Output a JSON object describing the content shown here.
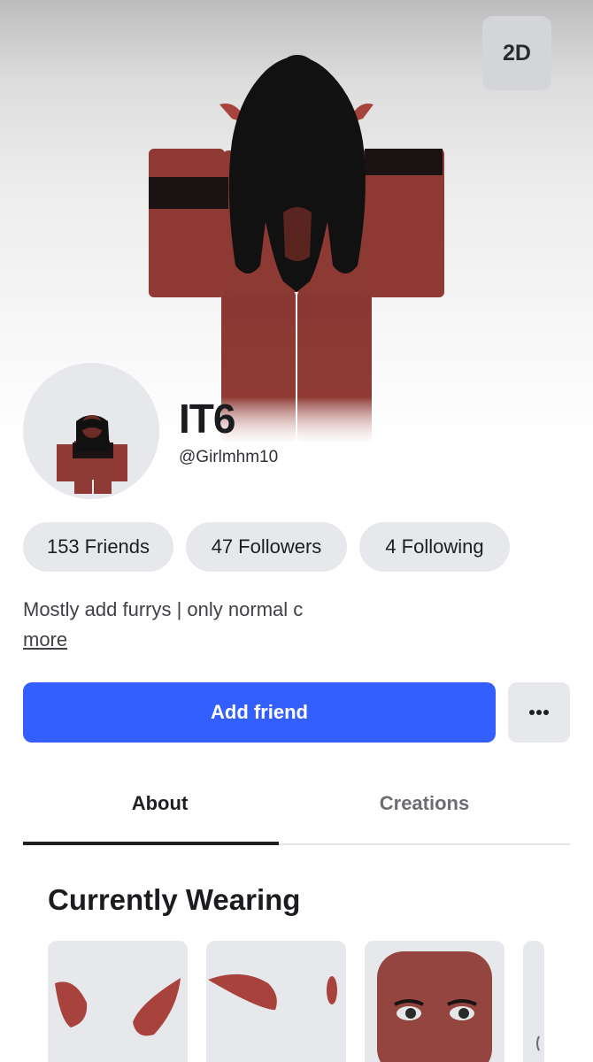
{
  "hero": {
    "view_toggle_label": "2D"
  },
  "profile": {
    "display_name": "IT6",
    "username": "@Girlmhm10"
  },
  "stats": [
    {
      "count": "153",
      "label": "Friends"
    },
    {
      "count": "47",
      "label": "Followers"
    },
    {
      "count": "4",
      "label": "Following"
    }
  ],
  "bio": {
    "text": "Mostly add furrys | only normal c",
    "more_label": "more"
  },
  "actions": {
    "add_friend_label": "Add friend",
    "more_options_icon": "ellipsis-icon"
  },
  "tabs": [
    {
      "label": "About",
      "active": true
    },
    {
      "label": "Creations",
      "active": false
    }
  ],
  "wearing": {
    "title": "Currently Wearing",
    "items": [
      {
        "icon": "horns-icon"
      },
      {
        "icon": "elf-ears-icon"
      },
      {
        "icon": "face-head-icon"
      },
      {
        "icon": "partial-item-icon"
      }
    ]
  },
  "colors": {
    "accent": "#335fff",
    "skin": "#8f3a35",
    "pill": "#e7e8eb"
  }
}
